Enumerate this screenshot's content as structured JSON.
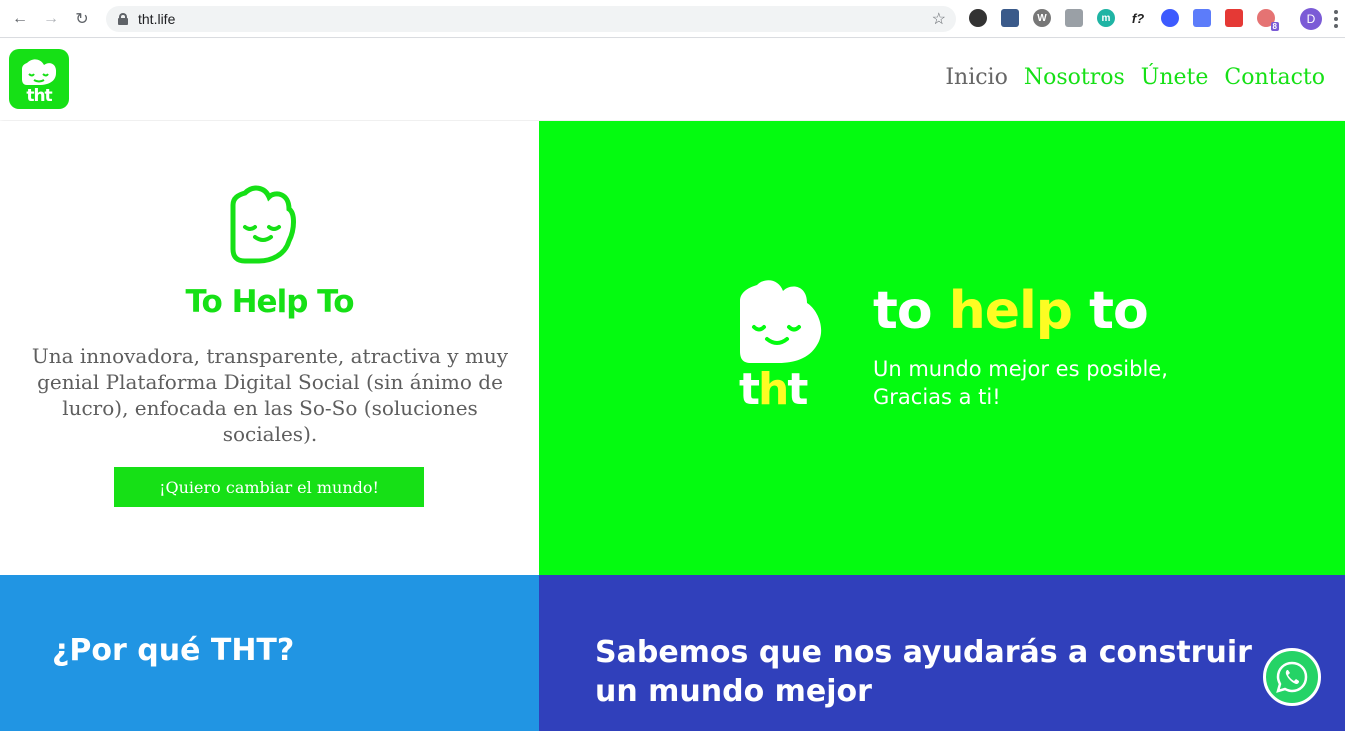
{
  "browser": {
    "url": "tht.life",
    "profile_initial": "D",
    "extensions": [
      "color-extension-icon",
      "screen-capture-icon",
      "wordpress-icon",
      "camera-icon",
      "m-extension-icon",
      "fx-extension-icon",
      "globe-extension-icon",
      "page-extension-icon",
      "record-extension-icon",
      "lens-extension-icon"
    ],
    "extension_badge": "8"
  },
  "header": {
    "logo_text": "tht",
    "nav": [
      {
        "label": "Inicio",
        "active": true
      },
      {
        "label": "Nosotros",
        "active": false
      },
      {
        "label": "Únete",
        "active": false
      },
      {
        "label": "Contacto",
        "active": false
      }
    ]
  },
  "hero_left": {
    "title": "To Help To",
    "description": "Una innovadora, transparente, atractiva y muy genial Plataforma Digital Social (sin ánimo de lucro), enfocada en las So-So (soluciones sociales).",
    "cta_label": "¡Quiero cambiar el mundo!"
  },
  "hero_right": {
    "logo_t1": "t",
    "logo_h": "h",
    "logo_t2": "t",
    "title_1": "to ",
    "title_help": "help",
    "title_2": " to",
    "subtitle_line1": "Un mundo mejor es posible,",
    "subtitle_line2": "Gracias a ti!"
  },
  "sections": {
    "why_title": "¿Por qué THT?",
    "build_title": "Sabemos que nos ayudarás a construir un mundo mejor"
  },
  "colors": {
    "brand_green": "#16e016",
    "hero_green": "#04fb10",
    "accent_yellow": "#fdfc23",
    "blue": "#2195e3",
    "indigo": "#3040bb",
    "whatsapp": "#25d366"
  }
}
